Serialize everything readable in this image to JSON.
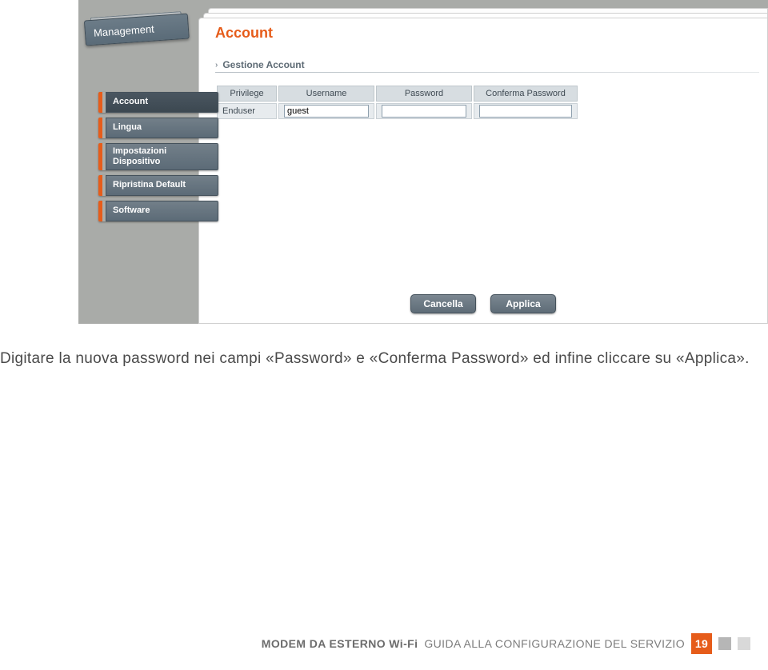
{
  "management_tab": {
    "label": "Management"
  },
  "sidebar": {
    "items": [
      {
        "label": "Account"
      },
      {
        "label": "Lingua"
      },
      {
        "label": "Impostazioni Dispositivo"
      },
      {
        "label": "Ripristina Default"
      },
      {
        "label": "Software"
      }
    ]
  },
  "main": {
    "title": "Account",
    "section_label": "Gestione Account",
    "table": {
      "headers": {
        "privilege": "Privilege",
        "username": "Username",
        "password": "Password",
        "confirm": "Conferma Password"
      },
      "row": {
        "privilege": "Enduser",
        "username": "guest",
        "password": "",
        "confirm": ""
      }
    },
    "buttons": {
      "cancel": "Cancella",
      "apply": "Applica"
    }
  },
  "instructions": "Digitare la nuova password nei campi «Password» e «Conferma Password» ed infine cliccare su «Applica».",
  "footer": {
    "bold": "MODEM DA ESTERNO Wi-Fi",
    "rest": "GUIDA ALLA CONFIGURAZIONE DEL SERVIZIO",
    "page": "19"
  }
}
